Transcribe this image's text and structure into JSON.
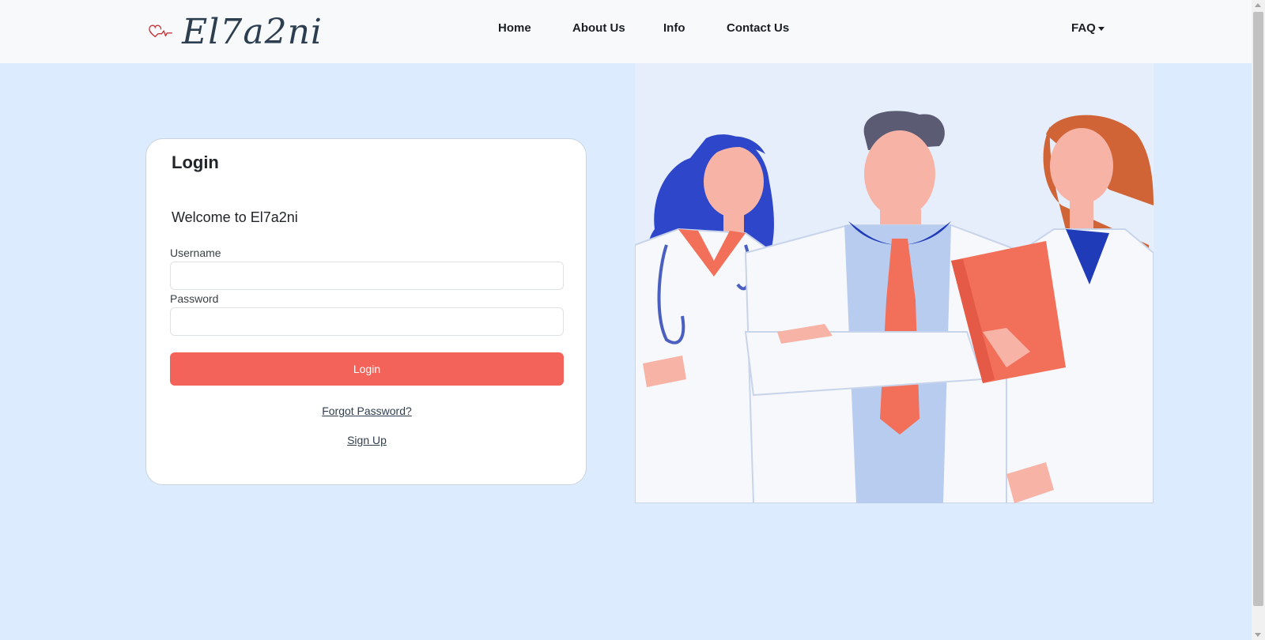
{
  "navbar": {
    "brand": "El7a2ni",
    "links": [
      "Home",
      "About Us",
      "Info",
      "Contact Us"
    ],
    "dropdown_label": "FAQ"
  },
  "login_card": {
    "title": "Login",
    "welcome": "Welcome to El7a2ni",
    "username_label": "Username",
    "username_value": "",
    "password_label": "Password",
    "password_value": "",
    "submit_label": "Login",
    "forgot_link": "Forgot Password?",
    "signup_link": "Sign Up"
  },
  "colors": {
    "page_bg": "#dcebfd",
    "navbar_bg": "#f8f9fa",
    "accent": "#f4635a",
    "heart": "#d9534f"
  },
  "icons": {
    "brand_logo": "heart-pulse-icon",
    "dropdown_caret": "caret-down-icon"
  },
  "illustration": "doctors-illustration"
}
